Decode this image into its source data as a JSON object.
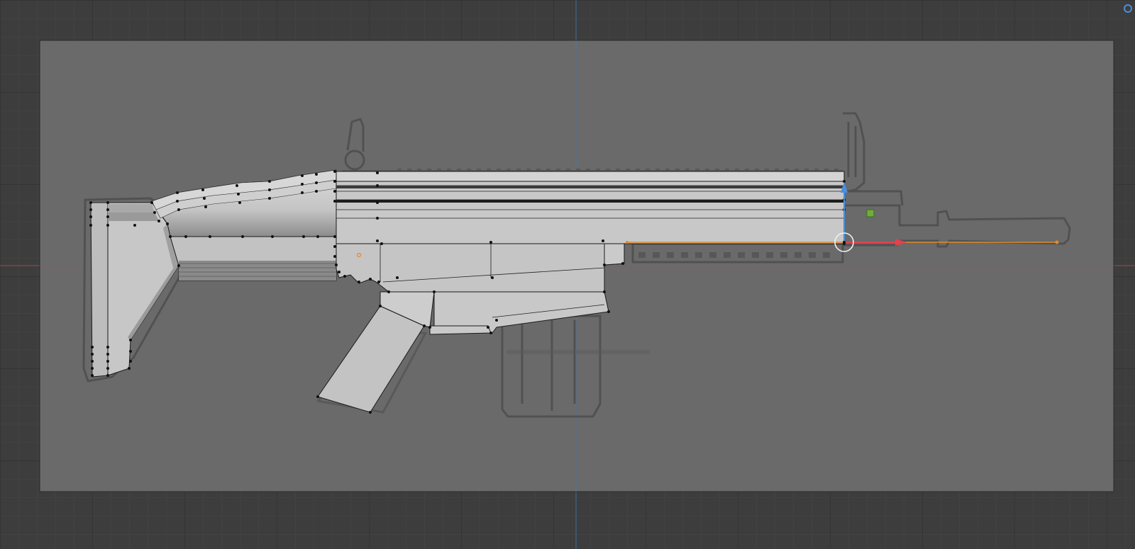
{
  "viewport": {
    "background_color": "#3d3d3d",
    "grid_color": "#474747",
    "grid_major_color": "#2f2f2f",
    "axis_x_color": "#9a4b4b",
    "axis_y_color": "#3f6fa8"
  },
  "reference_image": {
    "plane_color": "#6a6a6a",
    "outline_color": "#505050"
  },
  "mesh": {
    "face_color": "#c4c4c4",
    "edge_color": "#1a1a1a",
    "vertex_color": "#111111"
  },
  "gizmo": {
    "x_axis_color": "#e5414d",
    "z_axis_color": "#4a8fe0",
    "pivot_color": "#ffffff",
    "selection_color": "#e38a2a",
    "handle_color": "#6fae3a",
    "icons": [
      "move-gizmo-icon",
      "object-origin-icon"
    ]
  }
}
